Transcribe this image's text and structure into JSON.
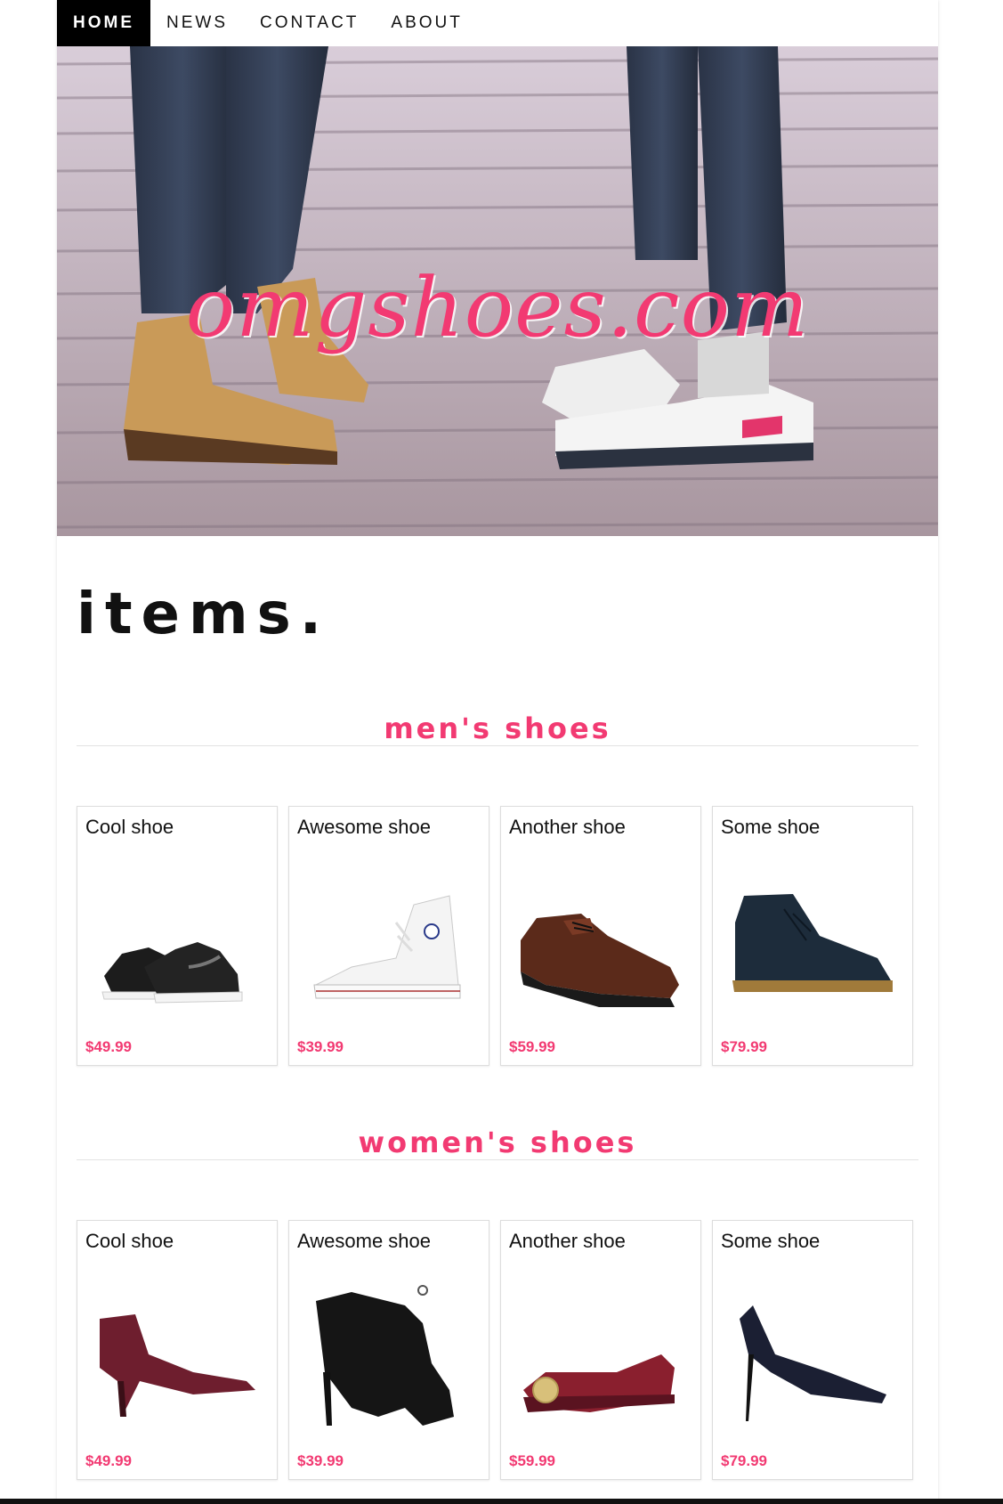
{
  "nav": {
    "items": [
      {
        "label": "HOME",
        "active": true
      },
      {
        "label": "NEWS",
        "active": false
      },
      {
        "label": "CONTACT",
        "active": false
      },
      {
        "label": "ABOUT",
        "active": false
      }
    ]
  },
  "hero": {
    "brand": "omgshoes.com"
  },
  "items_title": "items.",
  "colors": {
    "accent": "#f23a72"
  },
  "sections": [
    {
      "title": "men's shoes",
      "products": [
        {
          "name": "Cool shoe",
          "price": "$49.99",
          "image": "black-running-sneaker"
        },
        {
          "name": "Awesome shoe",
          "price": "$39.99",
          "image": "white-high-top-sneaker"
        },
        {
          "name": "Another shoe",
          "price": "$59.99",
          "image": "brown-leather-oxford"
        },
        {
          "name": "Some shoe",
          "price": "$79.99",
          "image": "navy-suede-chukka"
        }
      ]
    },
    {
      "title": "women's shoes",
      "products": [
        {
          "name": "Cool shoe",
          "price": "$49.99",
          "image": "burgundy-ankle-bootie"
        },
        {
          "name": "Awesome shoe",
          "price": "$39.99",
          "image": "black-peep-toe-bootie"
        },
        {
          "name": "Another shoe",
          "price": "$59.99",
          "image": "red-ballet-flat"
        },
        {
          "name": "Some shoe",
          "price": "$79.99",
          "image": "navy-stiletto-pump"
        }
      ]
    }
  ]
}
